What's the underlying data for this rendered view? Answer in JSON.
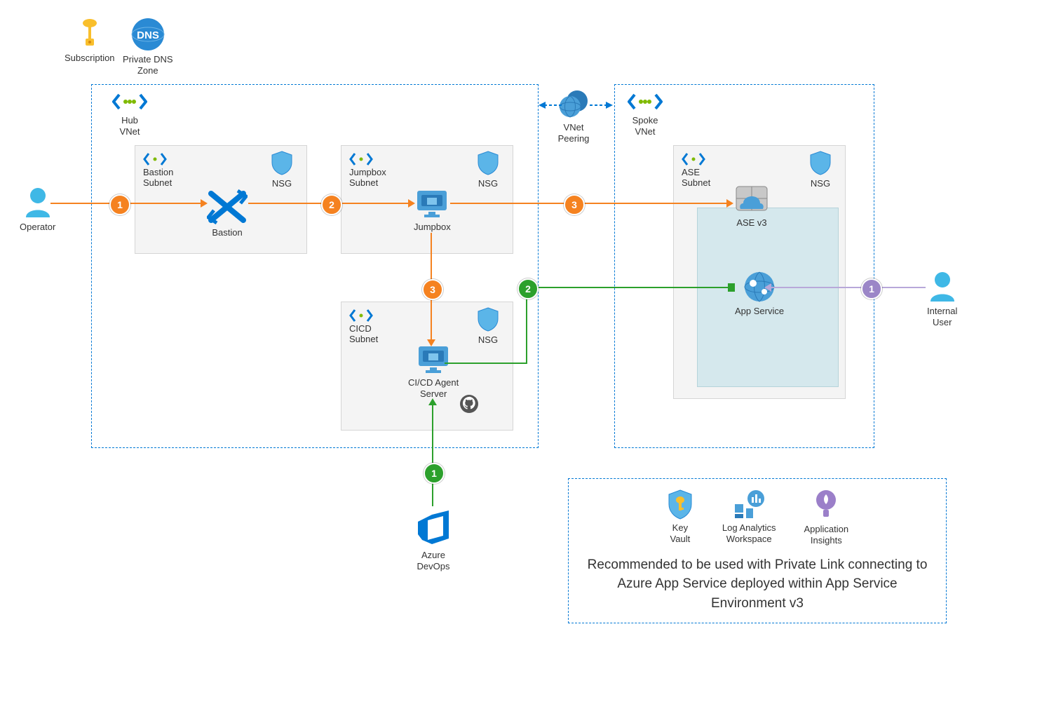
{
  "top": {
    "subscription": "Subscription",
    "pdz": "Private DNS\nZone"
  },
  "actors": {
    "operator": "Operator",
    "internal_user": "Internal\nUser",
    "azure_devops": "Azure\nDevOps"
  },
  "hub": {
    "vnet": "Hub\nVNet",
    "bastion_subnet": "Bastion\nSubnet",
    "bastion": "Bastion",
    "jumpbox_subnet": "Jumpbox\nSubnet",
    "jumpbox": "Jumpbox",
    "cicd_subnet": "CICD\nSubnet",
    "cicd": "CI/CD Agent\nServer"
  },
  "spoke": {
    "vnet": "Spoke\nVNet",
    "ase_subnet": "ASE\nSubnet",
    "ase": "ASE v3",
    "app_service": "App Service"
  },
  "nsg": "NSG",
  "peering": "VNet\nPeering",
  "reco": {
    "kv": "Key\nVault",
    "law": "Log Analytics\nWorkspace",
    "ai": "Application\nInsights",
    "text": "Recommended to be used with Private Link connecting to Azure App Service deployed within App Service Environment v3"
  },
  "nums": {
    "o1": "1",
    "o2": "2",
    "o3a": "3",
    "o3b": "3",
    "g1": "1",
    "g2": "2",
    "p1": "1"
  }
}
